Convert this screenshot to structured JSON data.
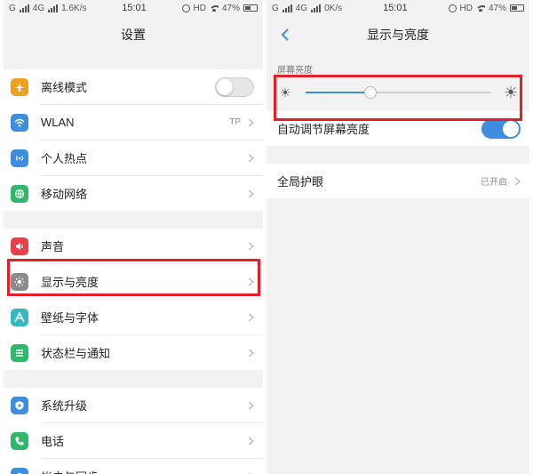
{
  "left": {
    "status": {
      "carrier": "G",
      "network": "4G",
      "speed": "1.6K/s",
      "time": "15:01",
      "hd": "HD",
      "battery": "47%"
    },
    "title": "设置",
    "groups": [
      [
        {
          "label": "离线模式",
          "icon": "airplane-icon",
          "color": "#f0a020",
          "control": "toggle-off"
        },
        {
          "label": "WLAN",
          "icon": "wifi-icon",
          "color": "#3d8de0",
          "value": "TP"
        },
        {
          "label": "个人热点",
          "icon": "hotspot-icon",
          "color": "#3d8de0"
        },
        {
          "label": "移动网络",
          "icon": "globe-icon",
          "color": "#2fb86a"
        }
      ],
      [
        {
          "label": "声音",
          "icon": "speaker-icon",
          "color": "#e8404a"
        },
        {
          "label": "显示与亮度",
          "icon": "brightness-icon",
          "color": "#8a8a8a",
          "highlighted": true
        },
        {
          "label": "壁纸与字体",
          "icon": "wallpaper-icon",
          "color": "#35b8c0"
        },
        {
          "label": "状态栏与通知",
          "icon": "notification-icon",
          "color": "#2fb86a"
        }
      ],
      [
        {
          "label": "系统升级",
          "icon": "update-icon",
          "color": "#3d8de0"
        },
        {
          "label": "电话",
          "icon": "phone-icon",
          "color": "#2fb86a"
        },
        {
          "label": "帐户与同步",
          "icon": "account-icon",
          "color": "#3d8de0"
        }
      ]
    ]
  },
  "right": {
    "status": {
      "carrier": "G",
      "network": "4G",
      "speed": "0K/s",
      "time": "15:01",
      "hd": "HD",
      "battery": "47%"
    },
    "title": "显示与亮度",
    "brightness_section_title": "屏幕亮度",
    "brightness_level": 0.35,
    "auto_brightness_label": "自动调节屏幕亮度",
    "auto_brightness_on": true,
    "eye_care_label": "全局护眼",
    "eye_care_value": "已开启"
  },
  "colors": {
    "accent": "#3d8de0",
    "highlight": "#e0202a"
  }
}
